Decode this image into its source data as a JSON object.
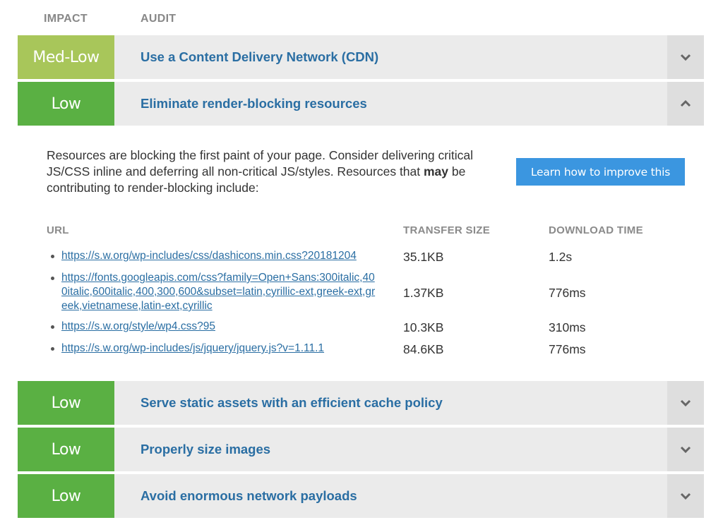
{
  "headers": {
    "impact": "IMPACT",
    "audit": "AUDIT"
  },
  "colors": {
    "med_low": "#a8c65a",
    "low": "#5ab043",
    "link": "#2a6ea3",
    "button": "#3b96e0"
  },
  "audits": [
    {
      "impact": "Med-Low",
      "title": "Use a Content Delivery Network (CDN)",
      "expanded": false,
      "toggle_icon": "chevron-down-icon"
    },
    {
      "impact": "Low",
      "title": "Eliminate render-blocking resources",
      "expanded": true,
      "toggle_icon": "chevron-up-icon"
    },
    {
      "impact": "Low",
      "title": "Serve static assets with an efficient cache policy",
      "expanded": false,
      "toggle_icon": "chevron-down-icon"
    },
    {
      "impact": "Low",
      "title": "Properly size images",
      "expanded": false,
      "toggle_icon": "chevron-down-icon"
    },
    {
      "impact": "Low",
      "title": "Avoid enormous network payloads",
      "expanded": false,
      "toggle_icon": "chevron-down-icon"
    }
  ],
  "details": {
    "desc_before": "Resources are blocking the first paint of your page. Consider delivering critical JS/CSS inline and deferring all non-critical JS/styles. Resources that ",
    "desc_bold": "may",
    "desc_after": " be contributing to render-blocking include:",
    "button_label": "Learn how to improve this",
    "columns": {
      "url": "URL",
      "size": "TRANSFER SIZE",
      "time": "DOWNLOAD TIME"
    },
    "resources": [
      {
        "url": "https://s.w.org/wp-includes/css/dashicons.min.css?20181204",
        "size": "35.1KB",
        "time": "1.2s"
      },
      {
        "url": "https://fonts.googleapis.com/css?family=Open+Sans:300italic,400italic,600italic,400,300,600&subset=latin,cyrillic-ext,greek-ext,greek,vietnamese,latin-ext,cyrillic",
        "size": "1.37KB",
        "time": "776ms"
      },
      {
        "url": "https://s.w.org/style/wp4.css?95",
        "size": "10.3KB",
        "time": "310ms"
      },
      {
        "url": "https://s.w.org/wp-includes/js/jquery/jquery.js?v=1.11.1",
        "size": "84.6KB",
        "time": "776ms"
      }
    ]
  }
}
